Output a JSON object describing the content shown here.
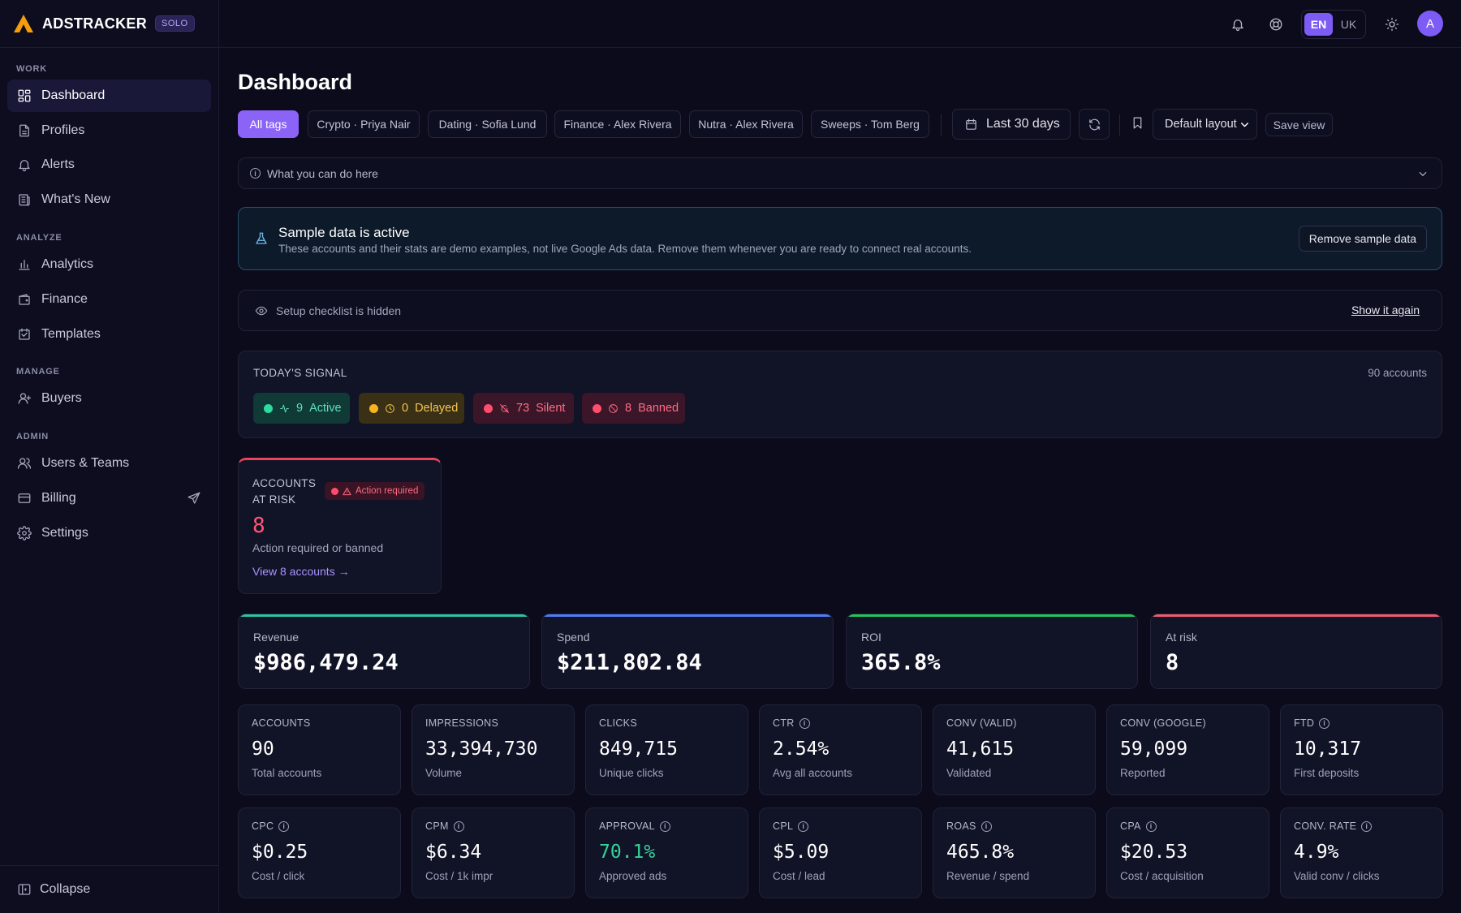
{
  "brand": {
    "name": "ADSTRACKER",
    "badge": "SOLO"
  },
  "sidebar": {
    "sections": {
      "work": "WORK",
      "analyze": "ANALYZE",
      "manage": "MANAGE",
      "admin": "ADMIN"
    },
    "items": {
      "dashboard": "Dashboard",
      "profiles": "Profiles",
      "alerts": "Alerts",
      "whats_new": "What's New",
      "analytics": "Analytics",
      "finance": "Finance",
      "templates": "Templates",
      "buyers": "Buyers",
      "users_teams": "Users & Teams",
      "billing": "Billing",
      "settings": "Settings"
    },
    "collapse": "Collapse"
  },
  "header": {
    "languages": [
      "EN",
      "UK"
    ],
    "active_language": "EN",
    "avatar_initial": "A"
  },
  "page": {
    "title": "Dashboard",
    "tags": [
      "All tags",
      "Crypto · Priya Nair",
      "Dating · Sofia Lund",
      "Finance · Alex Rivera",
      "Nutra · Alex Rivera",
      "Sweeps · Tom Berg"
    ],
    "date_range": "Last 30 days",
    "layout_select": "Default layout",
    "save_view": "Save view"
  },
  "help": {
    "label": "What you can do here"
  },
  "sample_banner": {
    "title": "Sample data is active",
    "description": "These accounts and their stats are demo examples, not live Google Ads data. Remove them whenever you are ready to connect real accounts.",
    "button": "Remove sample data"
  },
  "checklist": {
    "label": "Setup checklist is hidden",
    "link": "Show it again"
  },
  "signal": {
    "title": "TODAY'S SIGNAL",
    "accounts": "90 accounts",
    "chips": {
      "active": {
        "count": "9",
        "label": "Active"
      },
      "delayed": {
        "count": "0",
        "label": "Delayed"
      },
      "silent": {
        "count": "73",
        "label": "Silent"
      },
      "banned": {
        "count": "8",
        "label": "Banned"
      }
    }
  },
  "risk": {
    "title_line1": "ACCOUNTS",
    "title_line2": "AT RISK",
    "badge": "Action required",
    "value": "8",
    "description": "Action required or banned",
    "link": "View 8 accounts →"
  },
  "kpis": {
    "revenue": {
      "label": "Revenue",
      "value": "$986,479.24"
    },
    "spend": {
      "label": "Spend",
      "value": "$211,802.84"
    },
    "roi": {
      "label": "ROI",
      "value": "365.8%"
    },
    "at_risk": {
      "label": "At risk",
      "value": "8"
    }
  },
  "stats": {
    "accounts": {
      "label": "ACCOUNTS",
      "value": "90",
      "sub": "Total accounts"
    },
    "impressions": {
      "label": "IMPRESSIONS",
      "value": "33,394,730",
      "sub": "Volume"
    },
    "clicks": {
      "label": "CLICKS",
      "value": "849,715",
      "sub": "Unique clicks"
    },
    "ctr": {
      "label": "CTR",
      "value": "2.54%",
      "sub": "Avg all accounts"
    },
    "conv_valid": {
      "label": "CONV (VALID)",
      "value": "41,615",
      "sub": "Validated"
    },
    "conv_google": {
      "label": "CONV (GOOGLE)",
      "value": "59,099",
      "sub": "Reported"
    },
    "ftd": {
      "label": "FTD",
      "value": "10,317",
      "sub": "First deposits"
    },
    "cpc": {
      "label": "CPC",
      "value": "$0.25",
      "sub": "Cost / click"
    },
    "cpm": {
      "label": "CPM",
      "value": "$6.34",
      "sub": "Cost / 1k impr"
    },
    "approval": {
      "label": "APPROVAL",
      "value": "70.1%",
      "sub": "Approved ads"
    },
    "cpl": {
      "label": "CPL",
      "value": "$5.09",
      "sub": "Cost / lead"
    },
    "roas": {
      "label": "ROAS",
      "value": "465.8%",
      "sub": "Revenue / spend"
    },
    "cpa": {
      "label": "CPA",
      "value": "$20.53",
      "sub": "Cost / acquisition"
    },
    "conv_rate": {
      "label": "CONV. RATE",
      "value": "4.9%",
      "sub": "Valid conv / clicks"
    }
  },
  "colors": {
    "accent": "#8b63f7",
    "revenue_bar": "#2ec4a0",
    "spend_bar": "#4f7cf7",
    "roi_bar": "#22c55e",
    "risk_bar": "#ef5a6f",
    "approval_value": "#34d399"
  }
}
